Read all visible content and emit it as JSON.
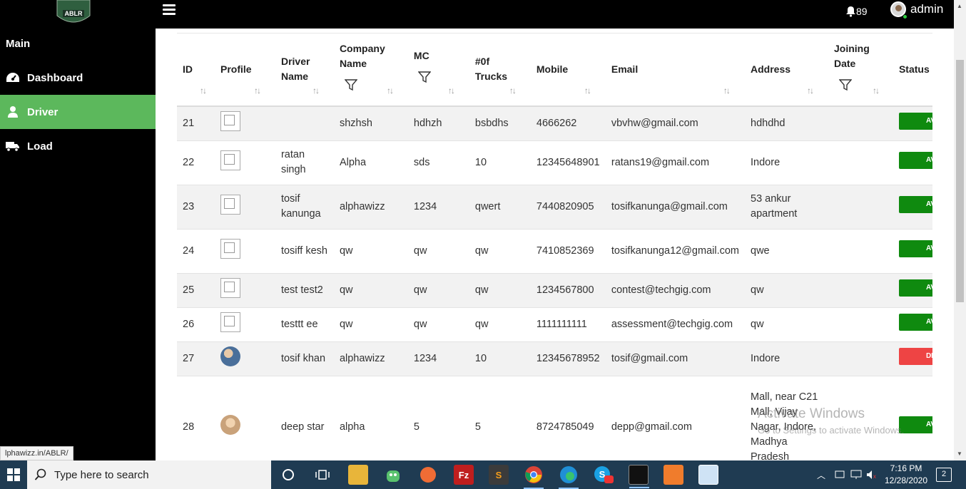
{
  "logo": {
    "text": "ABLR"
  },
  "sidebar": {
    "section_label": "Main",
    "items": [
      {
        "label": "Dashboard",
        "icon": "dashboard-icon",
        "active": false
      },
      {
        "label": "Driver",
        "icon": "driver-icon",
        "active": true
      },
      {
        "label": "Load",
        "icon": "truck-icon",
        "active": false
      }
    ]
  },
  "header": {
    "notification_count": "89",
    "user_name": "admin"
  },
  "table": {
    "columns": [
      {
        "label": "ID",
        "filter": false
      },
      {
        "label": "Profile",
        "filter": false
      },
      {
        "label": "Driver Name",
        "filter": false
      },
      {
        "label": "Company Name",
        "filter": true
      },
      {
        "label": "MC",
        "filter": true
      },
      {
        "label": "#0f Trucks",
        "filter": false
      },
      {
        "label": "Mobile",
        "filter": false
      },
      {
        "label": "Email",
        "filter": false
      },
      {
        "label": "Address",
        "filter": false
      },
      {
        "label": "Joining Date",
        "filter": true
      },
      {
        "label": "Status",
        "filter": false
      }
    ],
    "rows": [
      {
        "id": "21",
        "profile": "placeholder",
        "driver": "",
        "company": "shzhsh",
        "mc": "hdhzh",
        "trucks": "bsbdhs",
        "mobile": "4666262",
        "email": "vbvhw@gmail.com",
        "address": "hdhdhd",
        "joining": "",
        "status": "AVA",
        "status_color": "#0f8a0f"
      },
      {
        "id": "22",
        "profile": "placeholder",
        "driver": "ratan singh",
        "company": "Alpha",
        "mc": "sds",
        "trucks": "10",
        "mobile": "12345648901",
        "email": "ratans19@gmail.com",
        "address": "Indore",
        "joining": "",
        "status": "AVA",
        "status_color": "#0f8a0f"
      },
      {
        "id": "23",
        "profile": "placeholder",
        "driver": "tosif kanunga",
        "company": "alphawizz",
        "mc": "1234",
        "trucks": "qwert",
        "mobile": "7440820905",
        "email": "tosifkanunga@gmail.com",
        "address": "53 ankur apartment",
        "joining": "",
        "status": "AVA",
        "status_color": "#0f8a0f"
      },
      {
        "id": "24",
        "profile": "placeholder",
        "driver": "tosiff kesh",
        "company": "qw",
        "mc": "qw",
        "trucks": "qw",
        "mobile": "7410852369",
        "email": "tosifkanunga12@gmail.com",
        "address": "qwe",
        "joining": "",
        "status": "AVA",
        "status_color": "#0f8a0f"
      },
      {
        "id": "25",
        "profile": "placeholder",
        "driver": "test test2",
        "company": "qw",
        "mc": "qw",
        "trucks": "qw",
        "mobile": "1234567800",
        "email": "contest@techgig.com",
        "address": "qw",
        "joining": "",
        "status": "AVA",
        "status_color": "#0f8a0f"
      },
      {
        "id": "26",
        "profile": "placeholder",
        "driver": "testtt ee",
        "company": "qw",
        "mc": "qw",
        "trucks": "qw",
        "mobile": "1111111111",
        "email": "assessment@techgig.com",
        "address": "qw",
        "joining": "",
        "status": "AVA",
        "status_color": "#0f8a0f"
      },
      {
        "id": "27",
        "profile": "photo",
        "driver": "tosif khan",
        "company": "alphawizz",
        "mc": "1234",
        "trucks": "10",
        "mobile": "12345678952",
        "email": "tosif@gmail.com",
        "address": "Indore",
        "joining": "",
        "status": "DRI",
        "status_color": "#ee4444"
      },
      {
        "id": "28",
        "profile": "photo",
        "driver": "deep star",
        "company": "alpha",
        "mc": "5",
        "trucks": "5",
        "mobile": "8724785049",
        "email": "depp@gmail.com",
        "address": "Mall, near C21 Mall, Vijay Nagar, Indore, Madhya Pradesh",
        "joining": "",
        "status": "AVA",
        "status_color": "#0f8a0f"
      }
    ]
  },
  "status_url": "lphawizz.in/ABLR/",
  "watermark": {
    "line1": "Activate Windows",
    "line2": "Go to Settings to activate Windows."
  },
  "taskbar": {
    "search_placeholder": "Type here to search",
    "time": "7:16 PM",
    "date": "12/28/2020",
    "notifications": "2",
    "apps": [
      "task-view-icon",
      "file-explorer-icon",
      "android-icon",
      "postman-icon",
      "filezilla-icon",
      "sublime-icon",
      "chrome-icon",
      "edge-icon",
      "skype-icon",
      "terminal-icon",
      "xampp-icon",
      "notepad-icon"
    ]
  }
}
